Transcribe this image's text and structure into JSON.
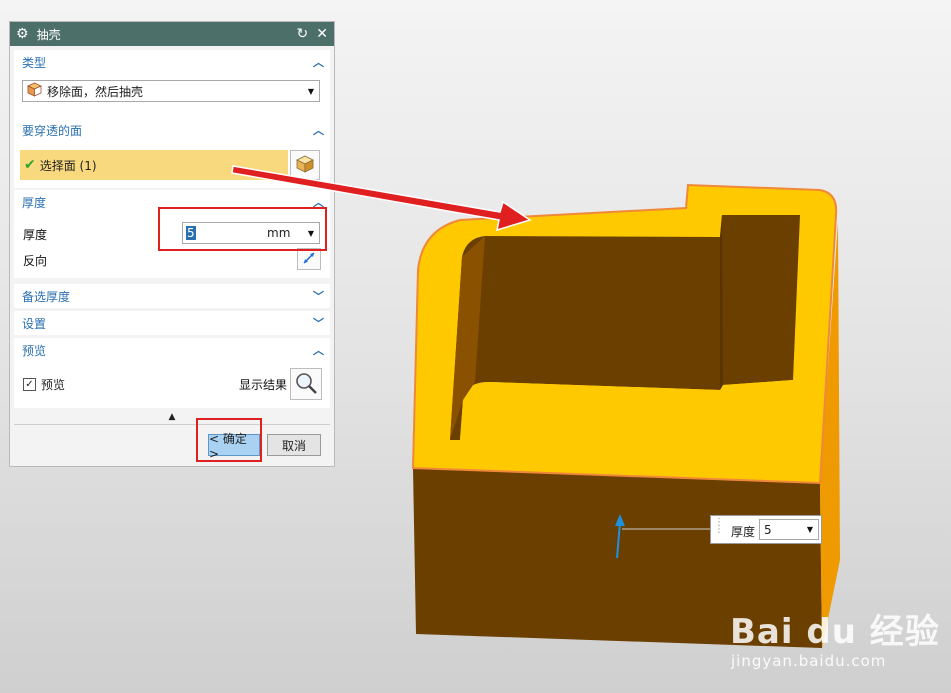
{
  "dialog": {
    "title": "抽壳",
    "type_section": {
      "header": "类型",
      "selected_type": "移除面，然后抽壳"
    },
    "faces_section": {
      "header": "要穿透的面",
      "select_label": "选择面 (1)"
    },
    "thickness_section": {
      "header": "厚度",
      "thickness_label": "厚度",
      "thickness_value": "5",
      "thickness_unit": "mm",
      "reverse_label": "反向"
    },
    "alt_thickness_header": "备选厚度",
    "settings_header": "设置",
    "preview_section": {
      "header": "预览",
      "preview_label": "预览",
      "preview_checked": true,
      "show_result_label": "显示结果"
    },
    "ok_label": "< 确定 >",
    "cancel_label": "取消"
  },
  "viewport": {
    "callout_label": "厚度",
    "callout_value": "5"
  },
  "watermark": {
    "line1": "Bai du 经验",
    "line2": "jingyan.baidu.com"
  },
  "colors": {
    "titlebar": "#4d6f6a",
    "accent_blue": "#2a6fb0",
    "highlight": "#f9d97e",
    "model_top": "#ffc900",
    "model_side": "#6b3f00",
    "annotation_red": "#e02020",
    "ok_button": "#a9d2f2"
  },
  "icons": [
    "gear-icon",
    "reset-icon",
    "close-icon",
    "shell-type-icon",
    "check-icon",
    "cube-icon",
    "reverse-direction-icon",
    "magnifier-icon",
    "chevron-up-icon",
    "chevron-down-icon"
  ]
}
